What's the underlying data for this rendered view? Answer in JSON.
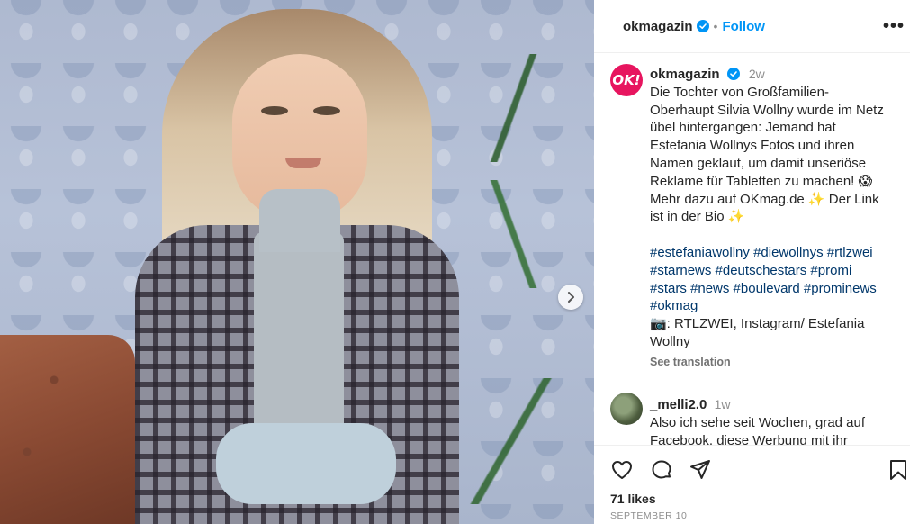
{
  "post": {
    "username": "okmagazin",
    "follow_label": "Follow",
    "separator": "•",
    "more_label": "•••",
    "avatar_text": "OK!",
    "time_ago": "2w",
    "caption_lines": [
      "Die Tochter von Großfamilien-",
      "Oberhaupt Silvia Wollny wurde im Netz",
      "übel hintergangen: Jemand hat",
      "Estefania Wollnys Fotos und ihren",
      "Namen geklaut, um damit unseriöse",
      "Reklame für Tabletten zu machen! 😱",
      "Mehr dazu auf OKmag.de ✨ Der Link",
      "ist in der Bio ✨"
    ],
    "hashtag_lines": [
      "#estefaniawollny #diewollnys #rtlzwei",
      "#starnews #deutschestars #promi",
      "#stars #news #boulevard #prominews",
      "#okmag"
    ],
    "credit_lines": [
      "📷: RTLZWEI, Instagram/ Estefania",
      "Wollny"
    ],
    "see_translation": "See translation"
  },
  "comment": {
    "username": "_melli2.0",
    "time_ago": "1w",
    "line1": "Also ich sehe seit Wochen, grad auf",
    "line2": "Facebook, diese Werbung mit ihr"
  },
  "footer": {
    "likes": "71 likes",
    "date": "SEPTEMBER 10"
  },
  "colors": {
    "brand": "#e7155f",
    "link": "#0095f6",
    "hashtag": "#00376b",
    "muted": "#8e8e8e"
  },
  "icons": [
    "verified-badge-icon",
    "more-options-icon",
    "heart-icon",
    "comment-icon",
    "share-icon",
    "bookmark-icon",
    "chevron-right-icon"
  ]
}
